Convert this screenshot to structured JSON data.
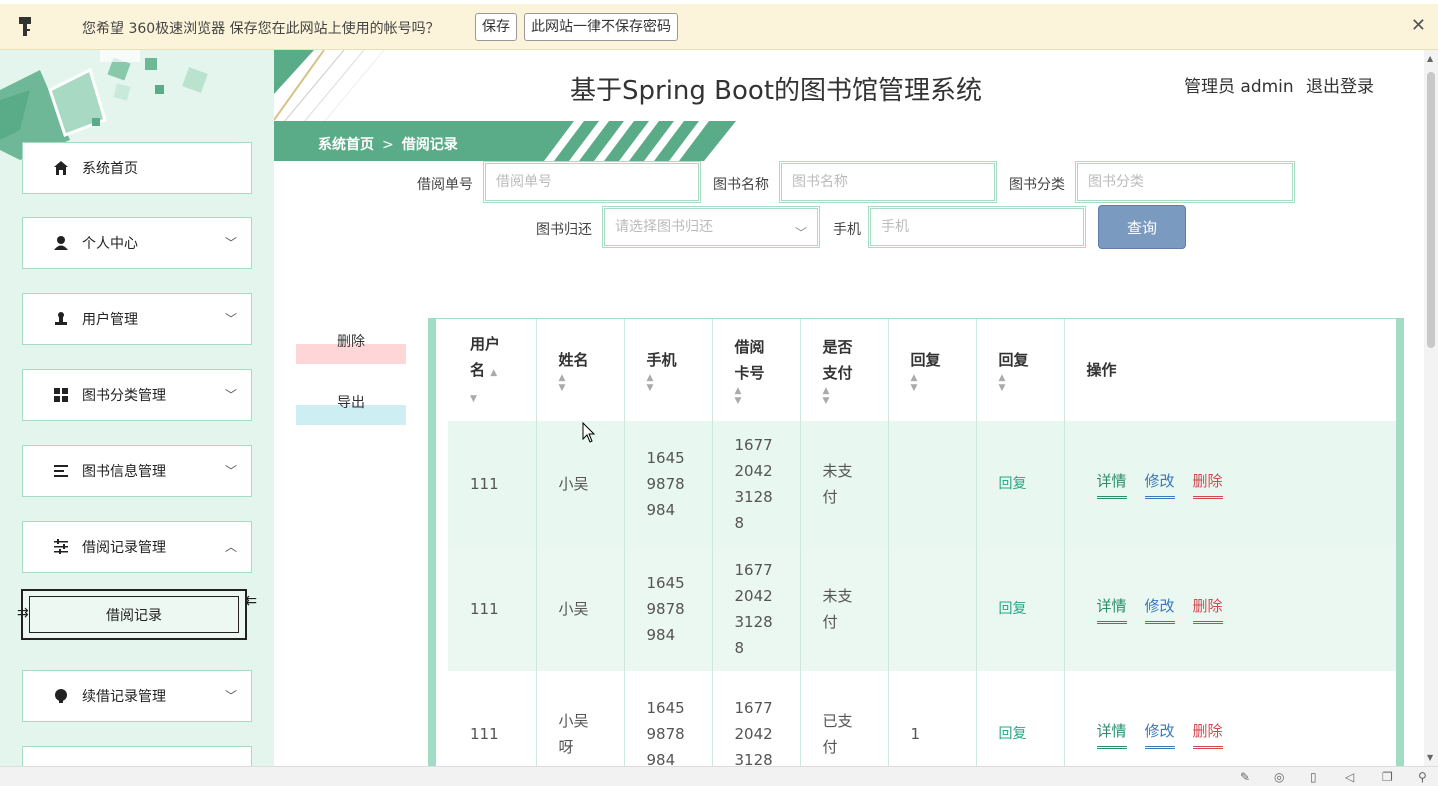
{
  "password_bar": {
    "message": "您希望 360极速浏览器 保存您在此网站上使用的帐号吗？",
    "save_label": "保存",
    "never_label": "此网站一律不保存密码",
    "close": "✕"
  },
  "header": {
    "title": "基于Spring Boot的图书馆管理系统",
    "admin": "管理员 admin",
    "logout": "退出登录"
  },
  "breadcrumb": {
    "home": "系统首页",
    "sep": ">",
    "current": "借阅记录"
  },
  "sidebar": {
    "items": [
      {
        "label": "系统首页",
        "icon": "home-icon"
      },
      {
        "label": "个人中心",
        "icon": "user-icon",
        "chevron": "﹀"
      },
      {
        "label": "用户管理",
        "icon": "stamp-icon",
        "chevron": "﹀"
      },
      {
        "label": "图书分类管理",
        "icon": "grid-icon",
        "chevron": "﹀"
      },
      {
        "label": "图书信息管理",
        "icon": "list-icon",
        "chevron": "﹀"
      },
      {
        "label": "借阅记录管理",
        "icon": "sliders-icon",
        "chevron": "︿"
      },
      {
        "label": "续借记录管理",
        "icon": "bulb-icon",
        "chevron": "﹀"
      }
    ],
    "sub_item": "借阅记录"
  },
  "search": {
    "borrow_no_label": "借阅单号",
    "borrow_no_placeholder": "借阅单号",
    "book_name_label": "图书名称",
    "book_name_placeholder": "图书名称",
    "book_cat_label": "图书分类",
    "book_cat_placeholder": "图书分类",
    "return_label": "图书归还",
    "return_placeholder": "请选择图书归还",
    "phone_label": "手机",
    "phone_placeholder": "手机",
    "query_label": "查询"
  },
  "actions": {
    "delete": "删除",
    "export": "导出"
  },
  "table": {
    "headers": {
      "username_a": "用户",
      "username_b": "名",
      "name": "姓名",
      "phone": "手机",
      "card_a": "借阅",
      "card_b": "卡号",
      "paid_a": "是否",
      "paid_b": "支付",
      "reply1": "回复",
      "reply2": "回复",
      "ops": "操作"
    },
    "rows": [
      {
        "username": "111",
        "name": "小吴",
        "phone": [
          "1645",
          "9878",
          "984"
        ],
        "card": [
          "1677",
          "2042",
          "3128",
          "8"
        ],
        "paid": [
          "未支",
          "付"
        ],
        "reply": "",
        "reply_link": "回复",
        "detail": "详情",
        "edit": "修改",
        "remove": "删除"
      },
      {
        "username": "111",
        "name": "小吴",
        "phone": [
          "1645",
          "9878",
          "984"
        ],
        "card": [
          "1677",
          "2042",
          "3128",
          "8"
        ],
        "paid": [
          "未支",
          "付"
        ],
        "reply": "",
        "reply_link": "回复",
        "detail": "详情",
        "edit": "修改",
        "remove": "删除"
      },
      {
        "username": "111",
        "name": [
          "小吴",
          "呀"
        ],
        "phone": [
          "1645",
          "9878",
          "984"
        ],
        "card": [
          "1677",
          "2042",
          "3128"
        ],
        "paid": [
          "已支",
          "付"
        ],
        "reply": "1",
        "reply_link": "回复",
        "detail": "详情",
        "edit": "修改",
        "remove": "删除"
      }
    ]
  },
  "colors": {
    "accent": "#5aab87",
    "sidebar_bg": "#e4f5ee",
    "query_btn": "#7b9ac0"
  }
}
